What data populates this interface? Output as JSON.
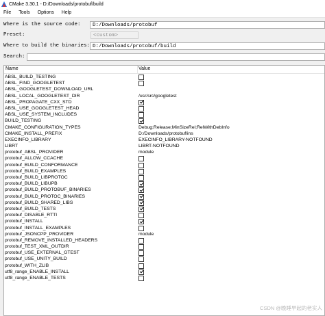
{
  "window": {
    "title": "CMake 3.30.1 - D:/Downloads/protobuf/build"
  },
  "menu": [
    "File",
    "Tools",
    "Options",
    "Help"
  ],
  "form": {
    "source_label": "Where is the source code:",
    "source_value": "D:/Downloads/protobuf",
    "preset_label": "Preset:",
    "preset_value": "<custom>",
    "build_label": "Where to build the binaries:",
    "build_value": "D:/Downloads/protobuf/build",
    "search_label": "Search:",
    "search_value": ""
  },
  "table": {
    "headers": {
      "name": "Name",
      "value": "Value"
    },
    "rows": [
      {
        "name": "ABSL_BUILD_TESTING",
        "type": "bool",
        "checked": false
      },
      {
        "name": "ABSL_FIND_GOOGLETEST",
        "type": "bool",
        "checked": false
      },
      {
        "name": "ABSL_GOOGLETEST_DOWNLOAD_URL",
        "type": "text",
        "value": ""
      },
      {
        "name": "ABSL_LOCAL_GOOGLETEST_DIR",
        "type": "text",
        "value": "/usr/src/googletest"
      },
      {
        "name": "ABSL_PROPAGATE_CXX_STD",
        "type": "bool",
        "checked": true
      },
      {
        "name": "ABSL_USE_GOOGLETEST_HEAD",
        "type": "bool",
        "checked": false
      },
      {
        "name": "ABSL_USE_SYSTEM_INCLUDES",
        "type": "bool",
        "checked": false
      },
      {
        "name": "BUILD_TESTING",
        "type": "bool",
        "checked": true
      },
      {
        "name": "CMAKE_CONFIGURATION_TYPES",
        "type": "text",
        "value": "Debug;Release;MinSizeRel;RelWithDebInfo"
      },
      {
        "name": "CMAKE_INSTALL_PREFIX",
        "type": "text",
        "value": "D:/Downloads/protobuf/ins"
      },
      {
        "name": "EXECINFO_LIBRARY",
        "type": "text",
        "value": "EXECINFO_LIBRARY-NOTFOUND"
      },
      {
        "name": "LIBRT",
        "type": "text",
        "value": "LIBRT-NOTFOUND"
      },
      {
        "name": "protobuf_ABSL_PROVIDER",
        "type": "text",
        "value": "module"
      },
      {
        "name": "protobuf_ALLOW_CCACHE",
        "type": "bool",
        "checked": false
      },
      {
        "name": "protobuf_BUILD_CONFORMANCE",
        "type": "bool",
        "checked": false
      },
      {
        "name": "protobuf_BUILD_EXAMPLES",
        "type": "bool",
        "checked": false
      },
      {
        "name": "protobuf_BUILD_LIBPROTOC",
        "type": "bool",
        "checked": false
      },
      {
        "name": "protobuf_BUILD_LIBUPB",
        "type": "bool",
        "checked": true
      },
      {
        "name": "protobuf_BUILD_PROTOBUF_BINARIES",
        "type": "bool",
        "checked": true
      },
      {
        "name": "protobuf_BUILD_PROTOC_BINARIES",
        "type": "bool",
        "checked": true
      },
      {
        "name": "protobuf_BUILD_SHARED_LIBS",
        "type": "bool",
        "checked": true
      },
      {
        "name": "protobuf_BUILD_TESTS",
        "type": "bool",
        "checked": true
      },
      {
        "name": "protobuf_DISABLE_RTTI",
        "type": "bool",
        "checked": false
      },
      {
        "name": "protobuf_INSTALL",
        "type": "bool",
        "checked": true
      },
      {
        "name": "protobuf_INSTALL_EXAMPLES",
        "type": "bool",
        "checked": false
      },
      {
        "name": "protobuf_JSONCPP_PROVIDER",
        "type": "text",
        "value": "module"
      },
      {
        "name": "protobuf_REMOVE_INSTALLED_HEADERS",
        "type": "bool",
        "checked": false
      },
      {
        "name": "protobuf_TEST_XML_OUTDIR",
        "type": "bool",
        "checked": false
      },
      {
        "name": "protobuf_USE_EXTERNAL_GTEST",
        "type": "bool",
        "checked": false
      },
      {
        "name": "protobuf_USE_UNITY_BUILD",
        "type": "bool",
        "checked": false
      },
      {
        "name": "protobuf_WITH_ZLIB",
        "type": "bool",
        "checked": false
      },
      {
        "name": "utf8_range_ENABLE_INSTALL",
        "type": "bool",
        "checked": true
      },
      {
        "name": "utf8_range_ENABLE_TESTS",
        "type": "bool",
        "checked": false
      }
    ]
  },
  "watermark": "CSDN @晚睡早起的老实人"
}
